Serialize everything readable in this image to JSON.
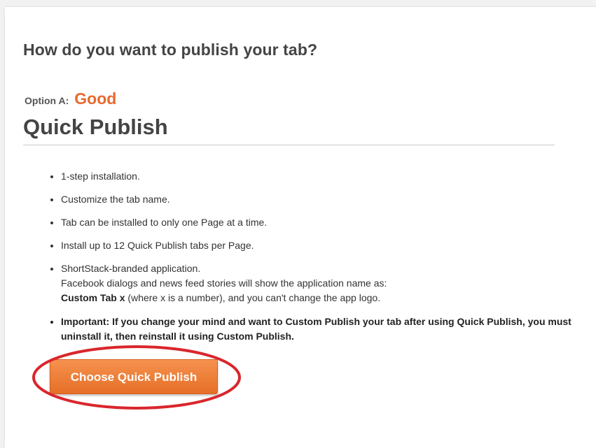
{
  "page": {
    "heading": "How do you want to publish your tab?"
  },
  "option": {
    "label": "Option A:",
    "rating": "Good",
    "title": "Quick Publish"
  },
  "features": [
    {
      "text": "1-step installation."
    },
    {
      "text": "Customize the tab name."
    },
    {
      "text": "Tab can be installed to only one Page at a time."
    },
    {
      "text": "Install up to 12 Quick Publish tabs per Page."
    },
    {
      "line1": "ShortStack-branded application.",
      "line2": "Facebook dialogs and news feed stories will show the application name as:",
      "bold": "Custom Tab x",
      "tail": " (where x is a number), and you can't change the app logo."
    },
    {
      "text": "Important: If you change your mind and want to Custom Publish your tab after using Quick Publish, you must uninstall it, then reinstall it using Custom Publish."
    }
  ],
  "cta": {
    "label": "Choose Quick Publish"
  },
  "colors": {
    "accent": "#e8692e",
    "button_top": "#f5924f",
    "button_bottom": "#e66f27",
    "highlight_ring": "#d9262c",
    "heading": "#444444"
  }
}
